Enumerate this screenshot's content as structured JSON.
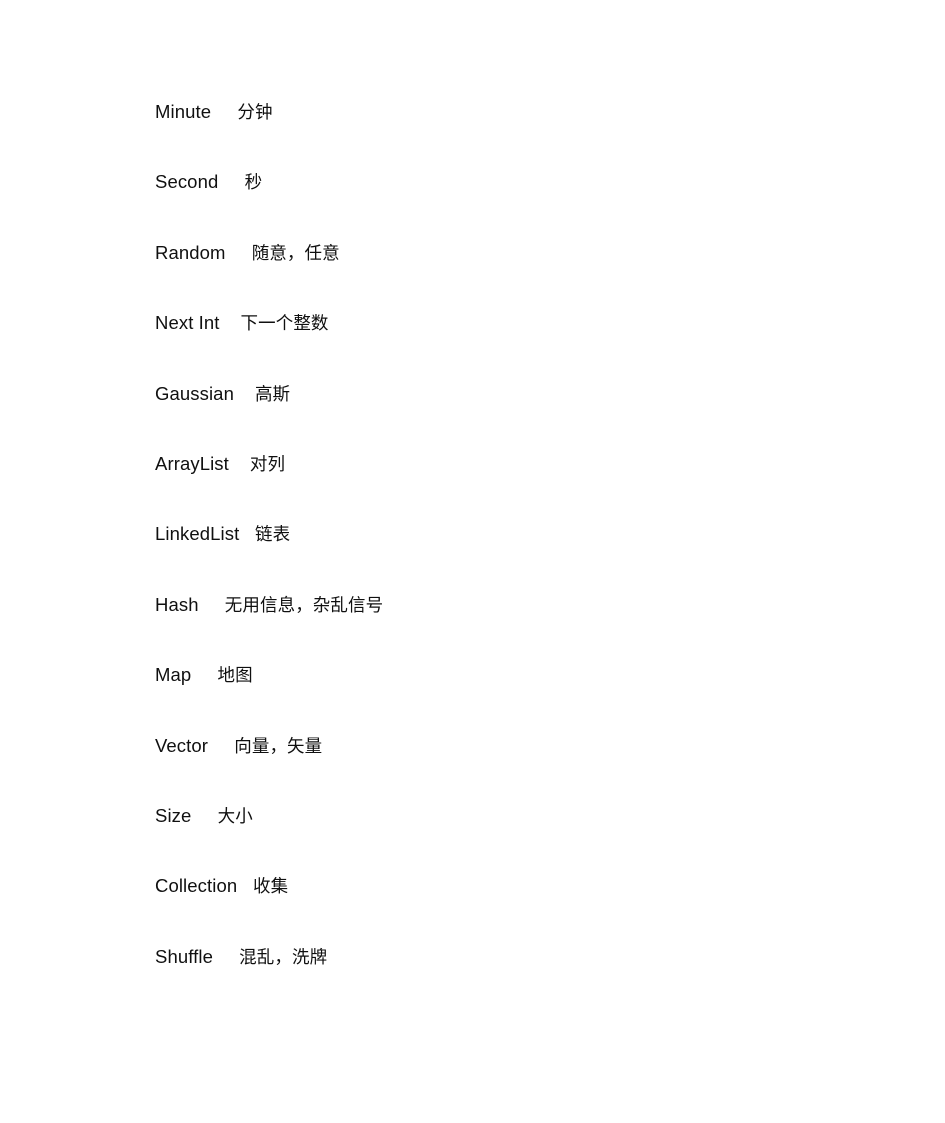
{
  "document": {
    "background_color": "#ffffff",
    "text_color": "#101010",
    "entries": [
      {
        "term": "Minute",
        "separator": "     ",
        "gloss": "分钟"
      },
      {
        "term": "Second",
        "separator": "     ",
        "gloss": "秒"
      },
      {
        "term": "Random",
        "separator": "     ",
        "gloss": "随意，任意"
      },
      {
        "term": "Next Int",
        "separator": "    ",
        "gloss": "下一个整数"
      },
      {
        "term": "Gaussian",
        "separator": "    ",
        "gloss": "高斯"
      },
      {
        "term": "ArrayList",
        "separator": "    ",
        "gloss": "对列"
      },
      {
        "term": "LinkedList",
        "separator": "   ",
        "gloss": "链表"
      },
      {
        "term": "Hash",
        "separator": "     ",
        "gloss": "无用信息，杂乱信号"
      },
      {
        "term": "Map",
        "separator": "     ",
        "gloss": "地图"
      },
      {
        "term": "Vector",
        "separator": "     ",
        "gloss": "向量，矢量"
      },
      {
        "term": "Size",
        "separator": "     ",
        "gloss": "大小"
      },
      {
        "term": "Collection",
        "separator": "   ",
        "gloss": "收集"
      },
      {
        "term": "Shuffle",
        "separator": "     ",
        "gloss": "混乱，洗牌"
      }
    ]
  }
}
